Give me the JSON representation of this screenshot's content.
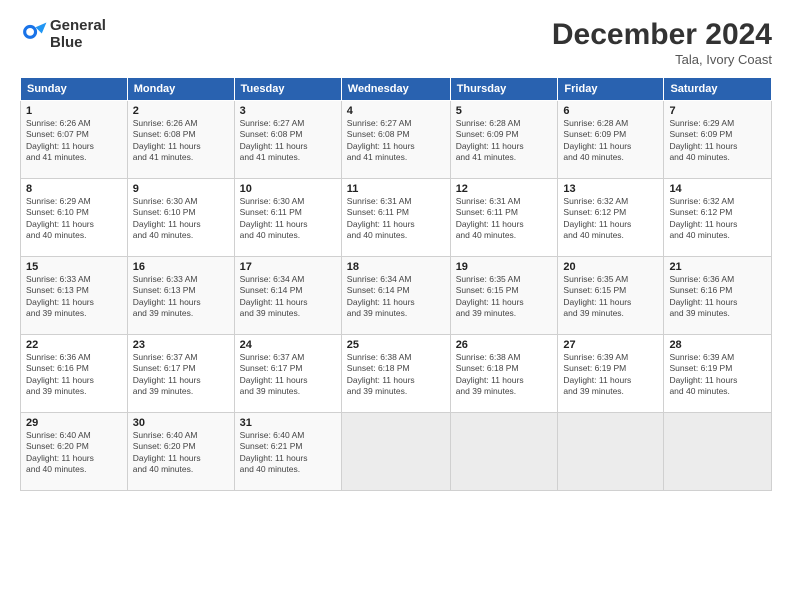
{
  "header": {
    "logo_line1": "General",
    "logo_line2": "Blue",
    "month_title": "December 2024",
    "location": "Tala, Ivory Coast"
  },
  "weekdays": [
    "Sunday",
    "Monday",
    "Tuesday",
    "Wednesday",
    "Thursday",
    "Friday",
    "Saturday"
  ],
  "weeks": [
    [
      {
        "day": "1",
        "info": "Sunrise: 6:26 AM\nSunset: 6:07 PM\nDaylight: 11 hours\nand 41 minutes."
      },
      {
        "day": "2",
        "info": "Sunrise: 6:26 AM\nSunset: 6:08 PM\nDaylight: 11 hours\nand 41 minutes."
      },
      {
        "day": "3",
        "info": "Sunrise: 6:27 AM\nSunset: 6:08 PM\nDaylight: 11 hours\nand 41 minutes."
      },
      {
        "day": "4",
        "info": "Sunrise: 6:27 AM\nSunset: 6:08 PM\nDaylight: 11 hours\nand 41 minutes."
      },
      {
        "day": "5",
        "info": "Sunrise: 6:28 AM\nSunset: 6:09 PM\nDaylight: 11 hours\nand 41 minutes."
      },
      {
        "day": "6",
        "info": "Sunrise: 6:28 AM\nSunset: 6:09 PM\nDaylight: 11 hours\nand 40 minutes."
      },
      {
        "day": "7",
        "info": "Sunrise: 6:29 AM\nSunset: 6:09 PM\nDaylight: 11 hours\nand 40 minutes."
      }
    ],
    [
      {
        "day": "8",
        "info": "Sunrise: 6:29 AM\nSunset: 6:10 PM\nDaylight: 11 hours\nand 40 minutes."
      },
      {
        "day": "9",
        "info": "Sunrise: 6:30 AM\nSunset: 6:10 PM\nDaylight: 11 hours\nand 40 minutes."
      },
      {
        "day": "10",
        "info": "Sunrise: 6:30 AM\nSunset: 6:11 PM\nDaylight: 11 hours\nand 40 minutes."
      },
      {
        "day": "11",
        "info": "Sunrise: 6:31 AM\nSunset: 6:11 PM\nDaylight: 11 hours\nand 40 minutes."
      },
      {
        "day": "12",
        "info": "Sunrise: 6:31 AM\nSunset: 6:11 PM\nDaylight: 11 hours\nand 40 minutes."
      },
      {
        "day": "13",
        "info": "Sunrise: 6:32 AM\nSunset: 6:12 PM\nDaylight: 11 hours\nand 40 minutes."
      },
      {
        "day": "14",
        "info": "Sunrise: 6:32 AM\nSunset: 6:12 PM\nDaylight: 11 hours\nand 40 minutes."
      }
    ],
    [
      {
        "day": "15",
        "info": "Sunrise: 6:33 AM\nSunset: 6:13 PM\nDaylight: 11 hours\nand 39 minutes."
      },
      {
        "day": "16",
        "info": "Sunrise: 6:33 AM\nSunset: 6:13 PM\nDaylight: 11 hours\nand 39 minutes."
      },
      {
        "day": "17",
        "info": "Sunrise: 6:34 AM\nSunset: 6:14 PM\nDaylight: 11 hours\nand 39 minutes."
      },
      {
        "day": "18",
        "info": "Sunrise: 6:34 AM\nSunset: 6:14 PM\nDaylight: 11 hours\nand 39 minutes."
      },
      {
        "day": "19",
        "info": "Sunrise: 6:35 AM\nSunset: 6:15 PM\nDaylight: 11 hours\nand 39 minutes."
      },
      {
        "day": "20",
        "info": "Sunrise: 6:35 AM\nSunset: 6:15 PM\nDaylight: 11 hours\nand 39 minutes."
      },
      {
        "day": "21",
        "info": "Sunrise: 6:36 AM\nSunset: 6:16 PM\nDaylight: 11 hours\nand 39 minutes."
      }
    ],
    [
      {
        "day": "22",
        "info": "Sunrise: 6:36 AM\nSunset: 6:16 PM\nDaylight: 11 hours\nand 39 minutes."
      },
      {
        "day": "23",
        "info": "Sunrise: 6:37 AM\nSunset: 6:17 PM\nDaylight: 11 hours\nand 39 minutes."
      },
      {
        "day": "24",
        "info": "Sunrise: 6:37 AM\nSunset: 6:17 PM\nDaylight: 11 hours\nand 39 minutes."
      },
      {
        "day": "25",
        "info": "Sunrise: 6:38 AM\nSunset: 6:18 PM\nDaylight: 11 hours\nand 39 minutes."
      },
      {
        "day": "26",
        "info": "Sunrise: 6:38 AM\nSunset: 6:18 PM\nDaylight: 11 hours\nand 39 minutes."
      },
      {
        "day": "27",
        "info": "Sunrise: 6:39 AM\nSunset: 6:19 PM\nDaylight: 11 hours\nand 39 minutes."
      },
      {
        "day": "28",
        "info": "Sunrise: 6:39 AM\nSunset: 6:19 PM\nDaylight: 11 hours\nand 40 minutes."
      }
    ],
    [
      {
        "day": "29",
        "info": "Sunrise: 6:40 AM\nSunset: 6:20 PM\nDaylight: 11 hours\nand 40 minutes."
      },
      {
        "day": "30",
        "info": "Sunrise: 6:40 AM\nSunset: 6:20 PM\nDaylight: 11 hours\nand 40 minutes."
      },
      {
        "day": "31",
        "info": "Sunrise: 6:40 AM\nSunset: 6:21 PM\nDaylight: 11 hours\nand 40 minutes."
      },
      {
        "day": "",
        "info": ""
      },
      {
        "day": "",
        "info": ""
      },
      {
        "day": "",
        "info": ""
      },
      {
        "day": "",
        "info": ""
      }
    ]
  ]
}
